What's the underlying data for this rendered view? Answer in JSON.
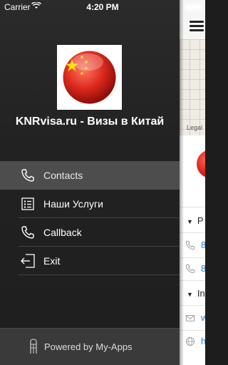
{
  "status_bar": {
    "carrier": "Carrier",
    "time": "4:20 PM"
  },
  "drawer": {
    "app_title": "KNRvisa.ru - Визы в Китай",
    "menu": [
      {
        "label": "Contacts",
        "icon": "phone-icon",
        "active": true
      },
      {
        "label": "Наши Услуги",
        "icon": "list-icon",
        "active": false
      },
      {
        "label": "Callback",
        "icon": "phone-icon",
        "active": false
      },
      {
        "label": "Exit",
        "icon": "exit-icon",
        "active": false
      }
    ],
    "footer": {
      "text": "Powered by My-Apps",
      "icon": "my-apps-icon"
    }
  },
  "content": {
    "map_legal": "Legal",
    "section1_letter": "P",
    "phone1_letter": "8",
    "phone2_letter": "8",
    "section2_letter": "In",
    "email_letter": "w",
    "web_letter": "h"
  },
  "colors": {
    "drawer_bg": "#222222",
    "active_row": "#4d4d4d",
    "link": "#2a7ec8",
    "flag_red": "#d8231b"
  }
}
